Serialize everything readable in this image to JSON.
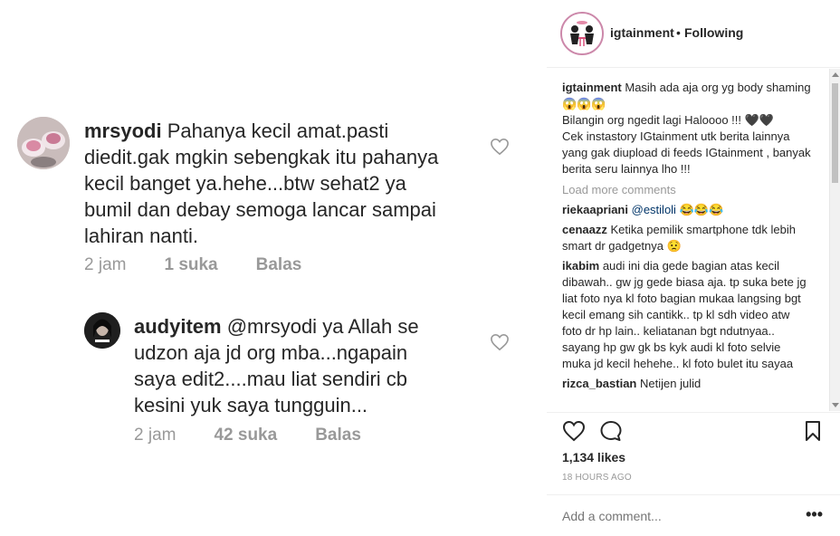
{
  "post_image": {
    "comment1": {
      "username": "mrsyodi",
      "text_line1": "Pahanya kecil amat.pasti",
      "text_line2": "diedit.gak mgkin sebengkak itu pahanya",
      "text_line3": "kecil banget ya.hehe...btw sehat2 ya",
      "text_line4": "bumil dan debay semoga lancar sampai",
      "text_line5": "lahiran nanti.",
      "time": "2 jam",
      "likes": "1 suka",
      "reply": "Balas"
    },
    "comment2": {
      "username": "audyitem",
      "mention": "@mrsyodi",
      "text_line1": "ya Allah se",
      "text_line2": "udzon aja jd org mba...ngapain",
      "text_line3": "saya edit2....mau liat sendiri cb",
      "text_line4": "kesini yuk saya tungguin...",
      "time": "2 jam",
      "likes": "42 suka",
      "reply": "Balas"
    }
  },
  "header": {
    "username": "igtainment",
    "separator": "•",
    "follow_status": "Following"
  },
  "caption": {
    "username": "igtainment",
    "line1": "Masih ada aja org yg body shaming 😱😱😱",
    "line2": "Bilangin org ngedit lagi Haloooo !!! 🖤🖤",
    "line3": "Cek instastory IGtainment utk berita lainnya yang gak diupload di feeds IGtainment , banyak berita seru lainnya lho !!!"
  },
  "load_more": "Load more comments",
  "comments": [
    {
      "username": "riekaapriani",
      "mention": "@estiloli",
      "text": "😂😂😂"
    },
    {
      "username": "cenaazz",
      "mention": "",
      "text": "Ketika pemilik smartphone tdk lebih smart dr gadgetnya 😟"
    },
    {
      "username": "ikabim",
      "mention": "",
      "text": "audi ini dia gede bagian atas kecil dibawah.. gw jg gede biasa aja. tp suka bete jg liat foto nya kl foto bagian mukaa langsing bgt kecil emang sih cantikk.. tp kl sdh video atw foto dr hp lain.. keliatanan bgt ndutnyaa.. sayang hp gw gk bs kyk audi kl foto selvie muka jd kecil hehehe.. kl foto bulet itu sayaa"
    },
    {
      "username": "rizca_bastian",
      "mention": "",
      "text": "Netijen julid"
    }
  ],
  "likes": "1,134 likes",
  "timestamp": "18 HOURS AGO",
  "add_comment_placeholder": "Add a comment...",
  "more_options": "•••",
  "icons": [
    "heart-icon",
    "comment-icon",
    "bookmark-icon"
  ]
}
